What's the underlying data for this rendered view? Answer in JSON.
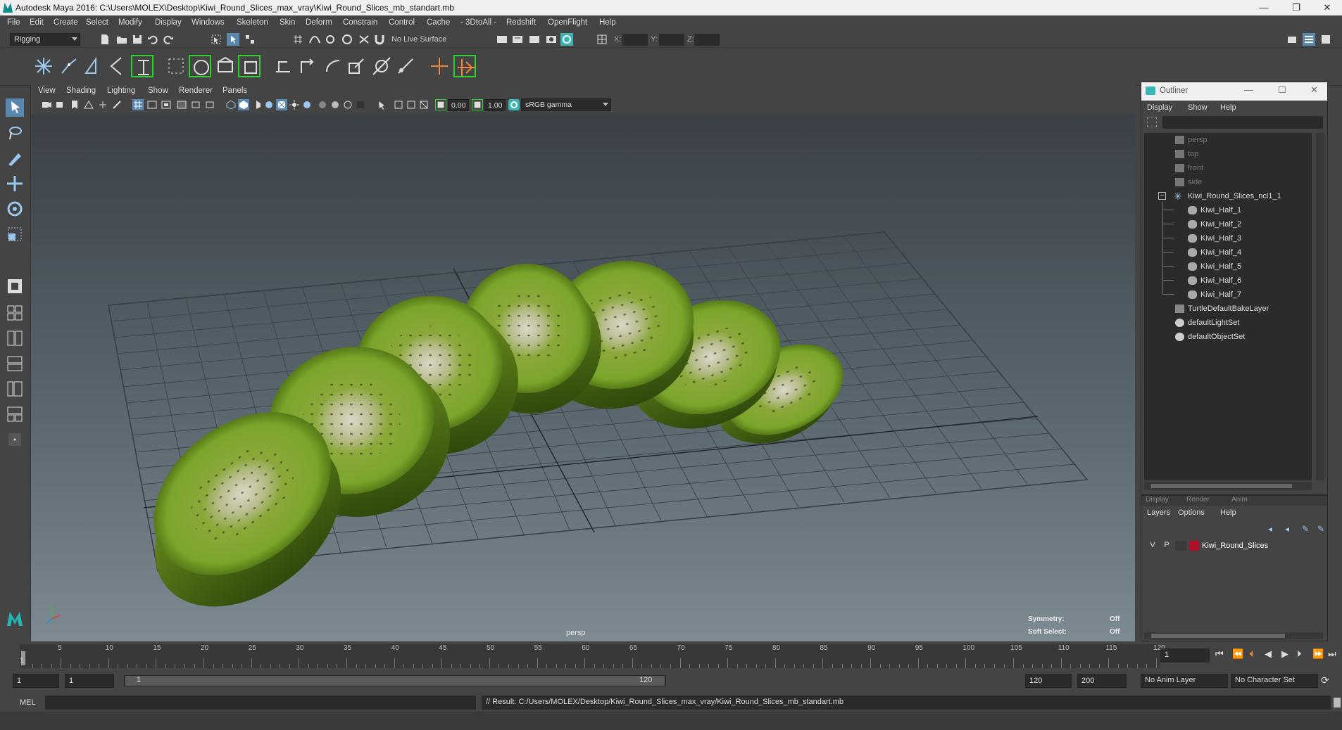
{
  "window": {
    "title": "Autodesk Maya 2016: C:\\Users\\MOLEX\\Desktop\\Kiwi_Round_Slices_max_vray\\Kiwi_Round_Slices_mb_standart.mb",
    "minimize": "—",
    "restore": "❐",
    "close": "✕"
  },
  "menubar": [
    "File",
    "Edit",
    "Create",
    "Select",
    "Modify",
    "Display",
    "Windows",
    "Skeleton",
    "Skin",
    "Deform",
    "Constrain",
    "Control",
    "Cache",
    "- 3DtoAll -",
    "Redshift",
    "OpenFlight",
    "Help"
  ],
  "statusline": {
    "mode": "Rigging",
    "live_surface": "No Live Surface",
    "x_label": "X:",
    "y_label": "Y:",
    "z_label": "Z:"
  },
  "viewport": {
    "menu": [
      "View",
      "Shading",
      "Lighting",
      "Show",
      "Renderer",
      "Panels"
    ],
    "exposure": "0.00",
    "gamma": "1.00",
    "color_space": "sRGB gamma",
    "camera_label": "persp",
    "symmetry_label": "Symmetry:",
    "symmetry_value": "Off",
    "soft_select_label": "Soft Select:",
    "soft_select_value": "Off"
  },
  "outliner": {
    "title": "Outliner",
    "menu": [
      "Display",
      "Show",
      "Help"
    ],
    "items": [
      {
        "label": "persp",
        "dim": true
      },
      {
        "label": "top",
        "dim": true
      },
      {
        "label": "front",
        "dim": true
      },
      {
        "label": "side",
        "dim": true
      },
      {
        "label": "Kiwi_Round_Slices_ncl1_1",
        "dim": false
      },
      {
        "label": "Kiwi_Half_1",
        "dim": false
      },
      {
        "label": "Kiwi_Half_2",
        "dim": false
      },
      {
        "label": "Kiwi_Half_3",
        "dim": false
      },
      {
        "label": "Kiwi_Half_4",
        "dim": false
      },
      {
        "label": "Kiwi_Half_5",
        "dim": false
      },
      {
        "label": "Kiwi_Half_6",
        "dim": false
      },
      {
        "label": "Kiwi_Half_7",
        "dim": false
      },
      {
        "label": "TurtleDefaultBakeLayer",
        "dim": false
      },
      {
        "label": "defaultLightSet",
        "dim": false
      },
      {
        "label": "defaultObjectSet",
        "dim": false
      }
    ]
  },
  "layer_editor": {
    "tabs": [
      "Display",
      "Render",
      "Anim"
    ],
    "menu": [
      "Layers",
      "Options",
      "Help"
    ],
    "layer": {
      "v": "V",
      "p": "P",
      "name": "Kiwi_Round_Slices",
      "color": "#b0102a"
    }
  },
  "timeslider": {
    "ticks": [
      "5",
      "10",
      "15",
      "20",
      "25",
      "30",
      "35",
      "40",
      "45",
      "50",
      "55",
      "60",
      "65",
      "70",
      "75",
      "80",
      "85",
      "90",
      "95",
      "100",
      "105",
      "110",
      "115",
      "120"
    ],
    "start_label": "1",
    "current_frame": "1"
  },
  "rangeslider": {
    "start": "1",
    "playback_start": "1",
    "range_start_label": "1",
    "range_end_label": "120",
    "playback_end": "120",
    "end": "200",
    "anim_layer": "No Anim Layer",
    "character_set": "No Character Set"
  },
  "cmdline": {
    "lang": "MEL",
    "result": "// Result: C:/Users/MOLEX/Desktop/Kiwi_Round_Slices_max_vray/Kiwi_Round_Slices_mb_standart.mb"
  }
}
